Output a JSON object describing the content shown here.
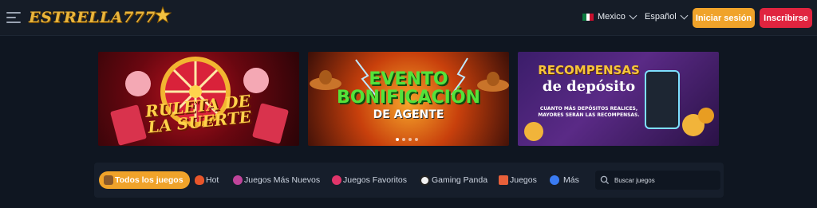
{
  "header": {
    "logo_text": "ESTRELLA777",
    "country": "Mexico",
    "language": "Español",
    "login_label": "Iniciar sesión",
    "register_label": "Inscribirse"
  },
  "banners": [
    {
      "title_line1": "RULETA DE",
      "title_line2": "LA SUERTE"
    },
    {
      "title_line1": "EVENTO",
      "title_line2": "BONIFICACIÓN",
      "title_line3": "DE AGENTE"
    },
    {
      "title_line1": "RECOMPENSAS",
      "title_line2": "de depósito",
      "caption_line1": "CUANTO MÁS DEPÓSITOS REALICES,",
      "caption_line2": "MAYORES SERÁN LAS RECOMPENSAS."
    }
  ],
  "tabs": [
    {
      "label": "Todos los juegos",
      "icon": "joystick-icon"
    },
    {
      "label": "Hot",
      "icon": "fire-icon"
    },
    {
      "label": "Juegos Más Nuevos",
      "icon": "new-icon"
    },
    {
      "label": "Juegos Favoritos",
      "icon": "heart-icon"
    },
    {
      "label": "Gaming Panda",
      "icon": "panda-icon"
    },
    {
      "label": "Juegos",
      "icon": "house-icon"
    },
    {
      "label": "Más",
      "icon": "more-icon"
    }
  ],
  "search": {
    "placeholder": "Buscar juegos"
  },
  "colors": {
    "accent": "#f0a32a",
    "register": "#e0243f",
    "background": "#0f1621"
  }
}
